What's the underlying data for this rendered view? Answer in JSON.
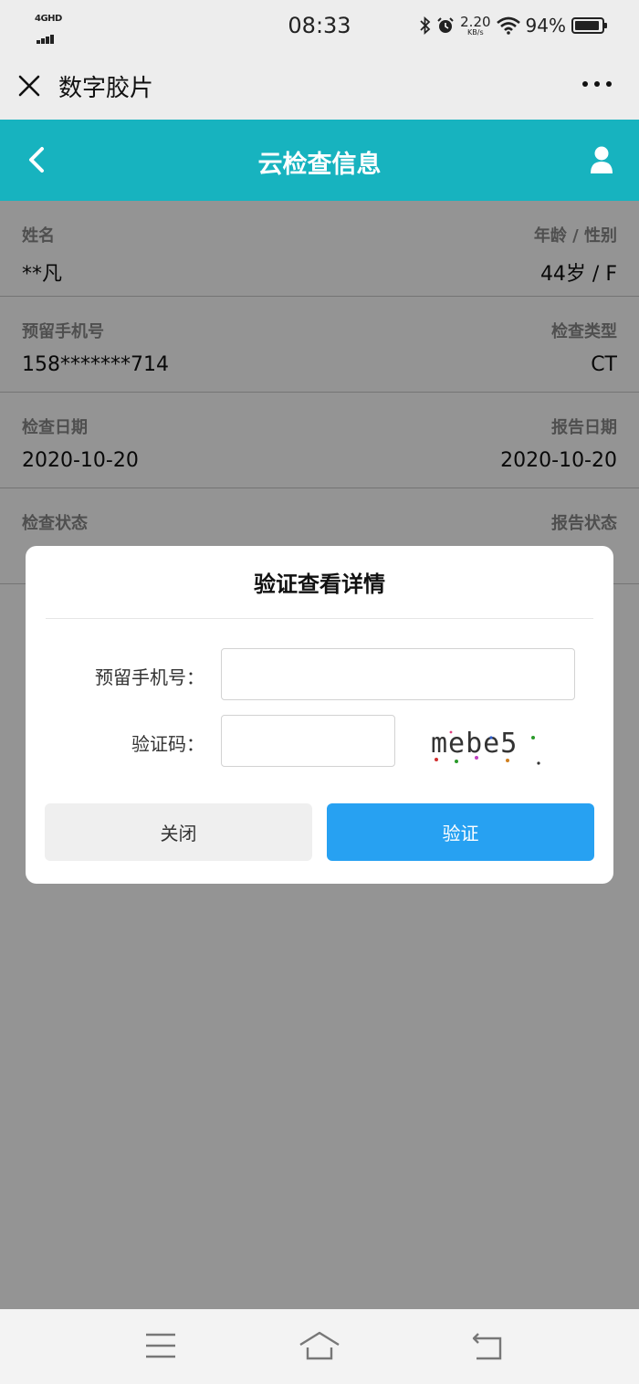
{
  "status_bar": {
    "network": "4GHD",
    "time": "08:33",
    "speed_value": "2.20",
    "speed_unit": "KB/s",
    "battery_percent": "94%",
    "battery_level": 0.94,
    "icons": [
      "bluetooth-icon",
      "alarm-icon",
      "wifi-icon",
      "battery-icon"
    ]
  },
  "wechat_bar": {
    "title": "数字胶片",
    "close_icon": "close-icon",
    "more_icon": "more-icon"
  },
  "header": {
    "title": "云检查信息",
    "back_icon": "chevron-left-icon",
    "user_icon": "user-icon",
    "background": "#17b3bf"
  },
  "info": {
    "name_label": "姓名",
    "name_value": "**凡",
    "age_sex_label": "年龄 / 性别",
    "age_sex_value": "44岁 / F",
    "phone_label": "预留手机号",
    "phone_value": "158*******714",
    "exam_type_label": "检查类型",
    "exam_type_value": "CT",
    "exam_date_label": "检查日期",
    "exam_date_value": "2020-10-20",
    "report_date_label": "报告日期",
    "report_date_value": "2020-10-20",
    "exam_status_label": "检查状态",
    "report_status_label": "报告状态"
  },
  "dialog": {
    "title": "验证查看详情",
    "phone_label": "预留手机号：",
    "phone_value": "",
    "code_label": "验证码：",
    "code_value": "",
    "captcha_text": "mebe5",
    "close_button": "关闭",
    "verify_button": "验证",
    "verify_color": "#27a1f2"
  },
  "nav": {
    "icons": [
      "menu-icon",
      "home-icon",
      "back-icon"
    ]
  }
}
